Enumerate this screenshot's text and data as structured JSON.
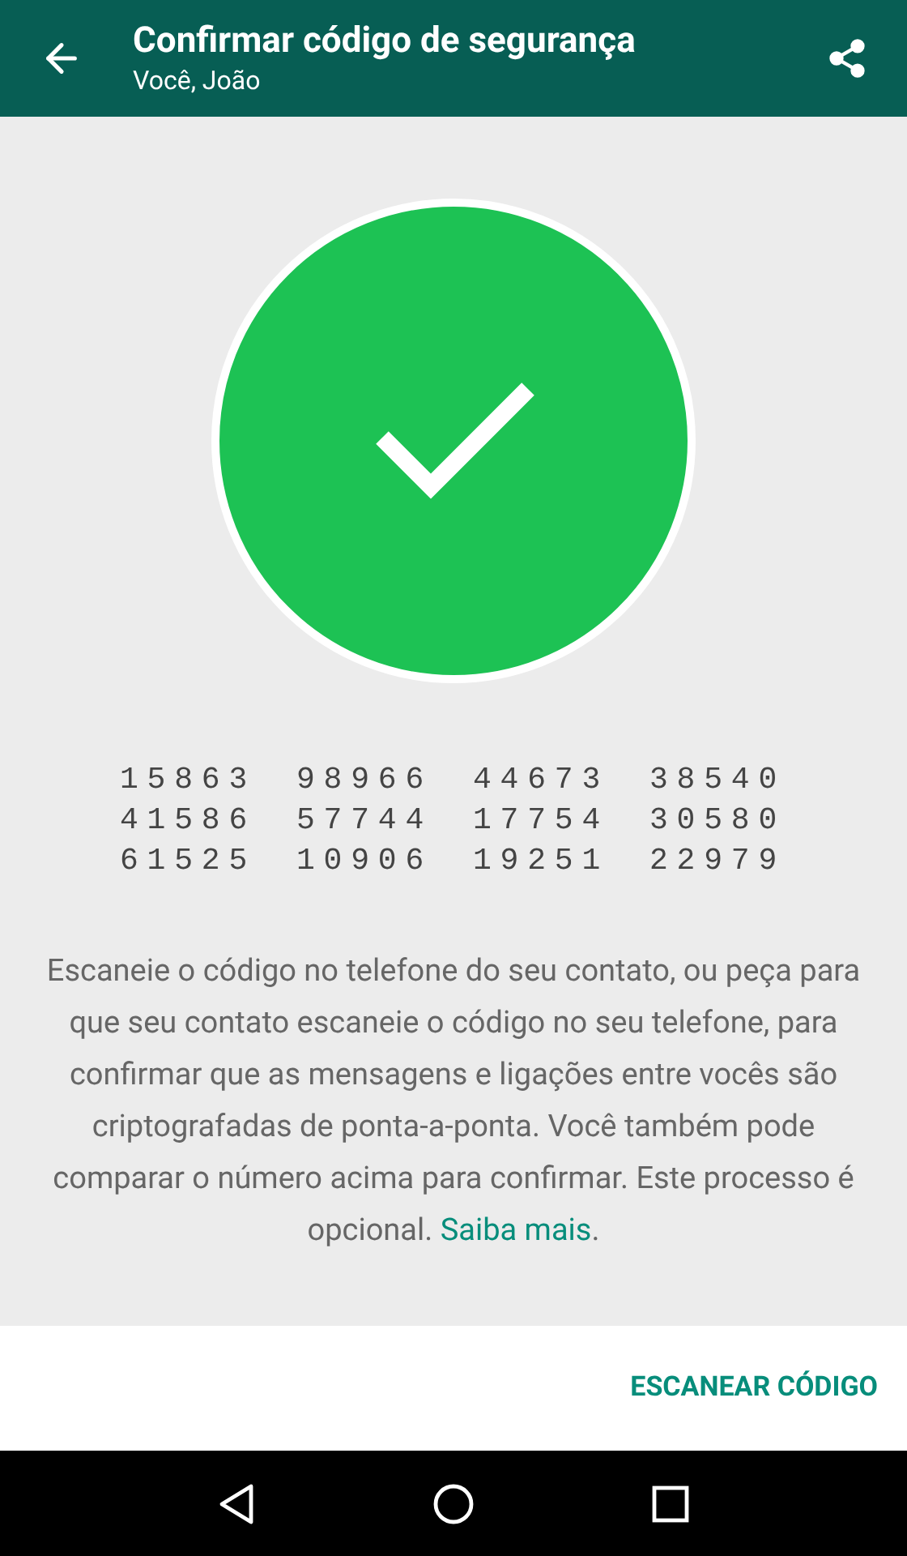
{
  "header": {
    "title": "Confirmar código de segurança",
    "subtitle": "Você, João"
  },
  "verified": true,
  "code_rows": [
    [
      "15863",
      "98966",
      "44673",
      "38540"
    ],
    [
      "41586",
      "57744",
      "17754",
      "30580"
    ],
    [
      "61525",
      "10906",
      "19251",
      "22979"
    ]
  ],
  "description": {
    "text": "Escaneie o código no telefone do seu contato, ou peça para que seu contato escaneie o código no seu telefone, para confirmar que as mensagens e ligações entre vocês são criptografadas de ponta-a-ponta. Você também pode comparar o número acima para confirmar. Este processo é opcional.",
    "link": "Saiba mais",
    "suffix": "."
  },
  "action_button": "ESCANEAR CÓDIGO"
}
